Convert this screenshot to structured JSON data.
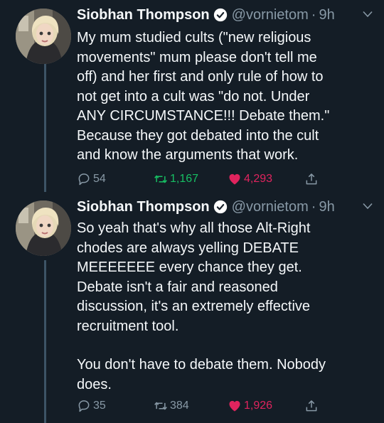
{
  "colors": {
    "background": "#141d26",
    "text": "#f5f8fa",
    "secondary": "#8899a6",
    "verified": "#ffffff",
    "retweet_active": "#17bf63",
    "like_active": "#e0245e"
  },
  "tweets": [
    {
      "author": {
        "name": "Siobhan Thompson",
        "handle": "@vornietom",
        "verified": true,
        "avatar_icon": "avatar-photo"
      },
      "separator": "·",
      "time": "9h",
      "menu_icon": "chevron-down-icon",
      "lines": [
        "My mum studied cults (\"new religious",
        "movements\" mum please don't tell me",
        "off) and her first and only rule of how to",
        "not get into a cult was \"do not. Under",
        "ANY CIRCUMSTANCE!!! Debate them.\"",
        "Because they got debated into the cult",
        "and know the arguments that work."
      ],
      "stats": {
        "replies": "54",
        "retweets": "1,167",
        "likes": "4,293",
        "retweeted": true,
        "liked": true
      }
    },
    {
      "author": {
        "name": "Siobhan Thompson",
        "handle": "@vornietom",
        "verified": true,
        "avatar_icon": "avatar-photo"
      },
      "separator": "·",
      "time": "9h",
      "menu_icon": "chevron-down-icon",
      "lines": [
        "So yeah that's why all those Alt-Right",
        "chodes are always yelling DEBATE",
        "MEEEEEEE every chance they get.",
        "Debate isn't a fair and reasoned",
        "discussion, it's an extremely effective",
        "recruitment tool.",
        "",
        "You don't have to debate them. Nobody",
        "does."
      ],
      "stats": {
        "replies": "35",
        "retweets": "384",
        "likes": "1,926",
        "retweeted": false,
        "liked": true
      }
    }
  ]
}
